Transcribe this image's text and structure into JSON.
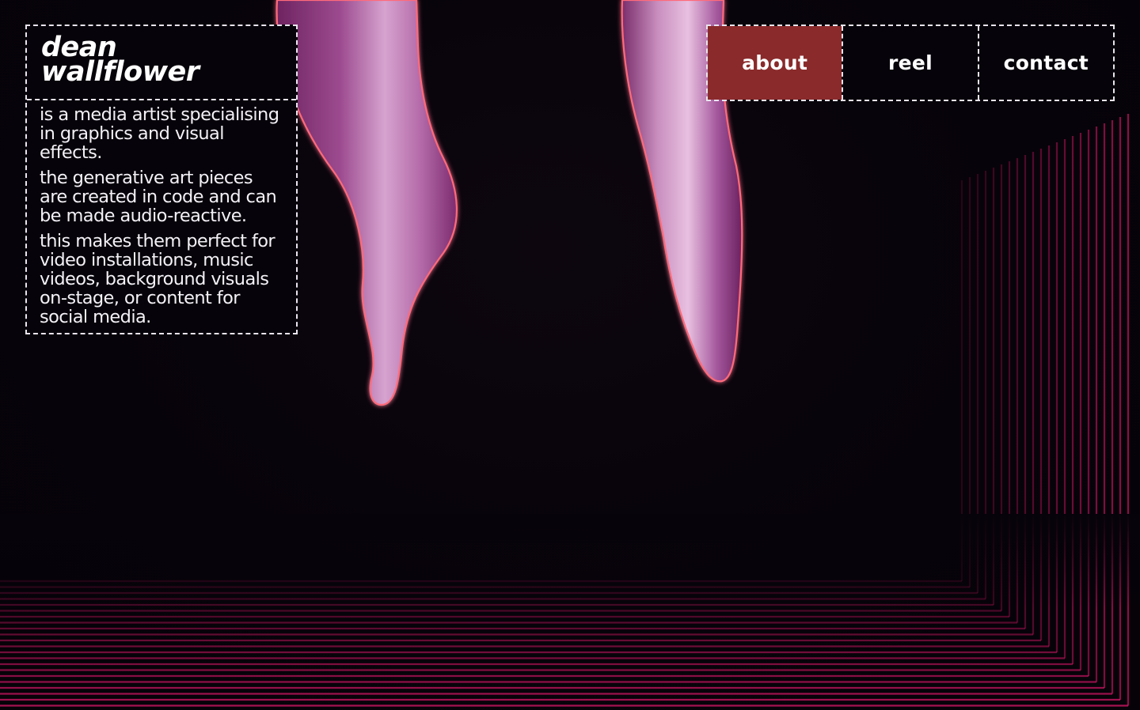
{
  "brand": {
    "line1": "dean",
    "line2": "wallflower"
  },
  "bio": {
    "paragraphs": [
      "is a media artist specialising in graphics and visual effects.",
      "the generative art pieces are created in code and can be made audio-reactive.",
      "this makes them perfect for video installations, music videos, background visuals on-stage, or content for social media."
    ]
  },
  "nav": {
    "items": [
      {
        "label": "about",
        "active": true
      },
      {
        "label": "reel",
        "active": false
      },
      {
        "label": "contact",
        "active": false
      }
    ]
  },
  "colors": {
    "background": "#07030a",
    "accent": "#8a2a2b",
    "border": "#e9e4ee",
    "glow": "#ff3b4f",
    "stripe": "#e0186b",
    "drip": "#b15aa6"
  }
}
